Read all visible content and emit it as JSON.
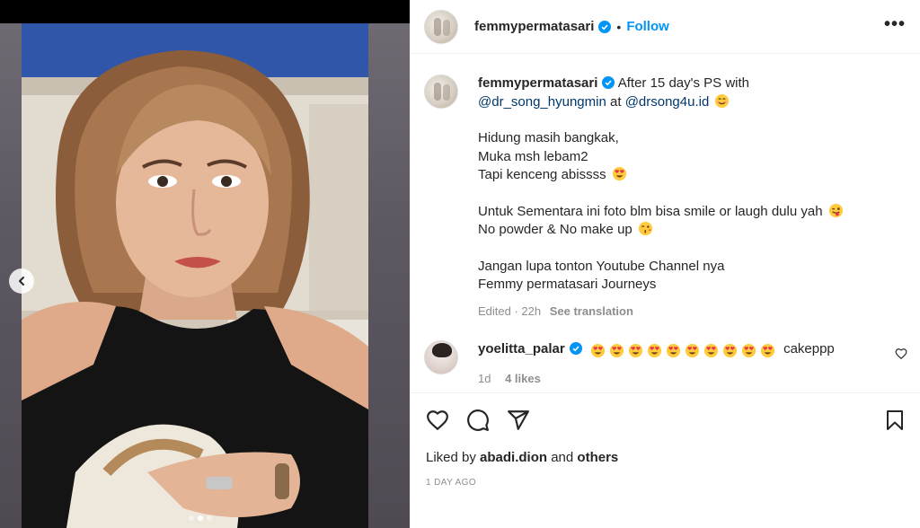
{
  "post": {
    "author": "femmypermatasari",
    "follow_label": "Follow",
    "separator": "•",
    "more_label": "•••",
    "caption": {
      "intro": "After 15 day's PS with",
      "mention1": "@dr_song_hyungmin",
      "at_word": "at",
      "mention2": "@drsong4u.id",
      "line1": "Hidung masih bangkak,",
      "line2": "Muka msh lebam2",
      "line3": "Tapi kenceng abissss",
      "line4": "Untuk Sementara ini foto blm bisa smile or laugh dulu yah",
      "line5": "No powder & No make up",
      "line6": "Jangan lupa tonton Youtube Channel nya",
      "line7": "Femmy permatasari Journeys",
      "edited": "Edited · 22h",
      "see_translation": "See translation"
    },
    "comment": {
      "username": "yoelitta_palar",
      "heart_eyes_count": 10,
      "text": "cakeppp",
      "time": "1d",
      "likes": "4 likes"
    },
    "liked_by_prefix": "Liked by",
    "liked_by_user": "abadi.dion",
    "liked_by_and": "and",
    "liked_by_others": "others",
    "date": "1 day ago"
  },
  "media": {
    "carousel_total": 3,
    "carousel_active": 2
  },
  "icons": {
    "verified": "verified-badge-icon",
    "heart": "heart-icon",
    "comment": "comment-icon",
    "share": "share-icon",
    "bookmark": "bookmark-icon",
    "prev": "chevron-left-icon"
  },
  "colors": {
    "accent": "#0095f6",
    "mention": "#00376b",
    "muted": "#8e8e8e"
  }
}
